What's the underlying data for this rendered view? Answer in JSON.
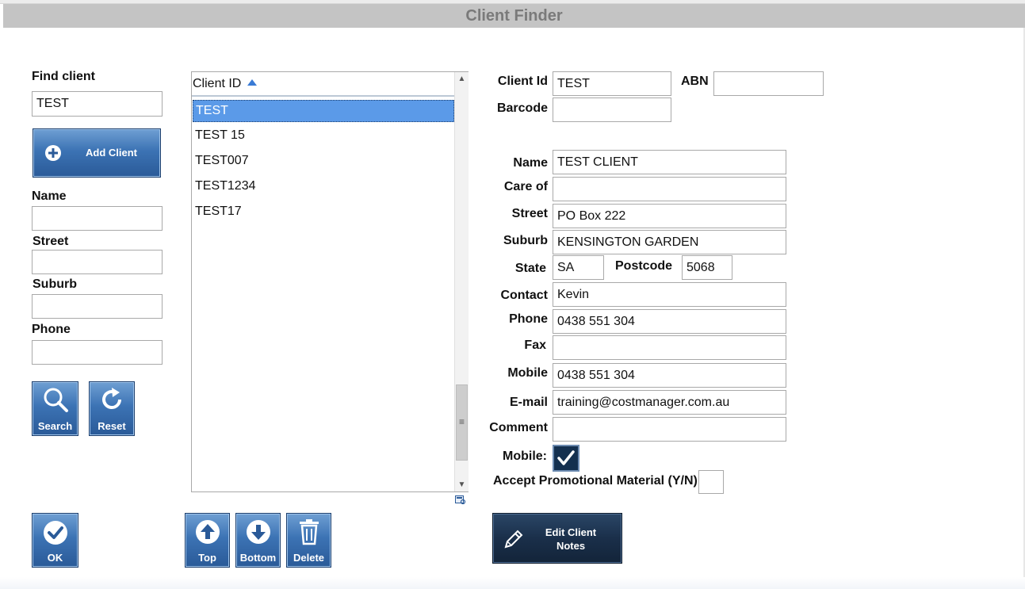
{
  "window": {
    "title": "Client Finder"
  },
  "search_panel": {
    "find_client_label": "Find client",
    "find_client_value": "TEST",
    "add_client_label": "Add Client",
    "name_label": "Name",
    "name_value": "",
    "street_label": "Street",
    "street_value": "",
    "suburb_label": "Suburb",
    "suburb_value": "",
    "phone_label": "Phone",
    "phone_value": "",
    "search_label": "Search",
    "reset_label": "Reset",
    "ok_label": "OK"
  },
  "client_list": {
    "column_header": "Client ID",
    "sort": "ascending",
    "rows": [
      "TEST",
      "TEST 15",
      "TEST007",
      "TEST1234",
      "TEST17"
    ],
    "selected_index": 0,
    "top_label": "Top",
    "bottom_label": "Bottom",
    "delete_label": "Delete"
  },
  "detail": {
    "client_id_label": "Client Id",
    "client_id_value": "TEST",
    "abn_label": "ABN",
    "abn_value": "",
    "barcode_label": "Barcode",
    "barcode_value": "",
    "name_label": "Name",
    "name_value": "TEST CLIENT",
    "care_of_label": "Care of",
    "care_of_value": "",
    "street_label": "Street",
    "street_value": "PO Box 222",
    "suburb_label": "Suburb",
    "suburb_value": "KENSINGTON GARDEN",
    "state_label": "State",
    "state_value": "SA",
    "postcode_label": "Postcode",
    "postcode_value": "5068",
    "contact_label": "Contact",
    "contact_value": "Kevin",
    "phone_label": "Phone",
    "phone_value": "0438 551 304",
    "fax_label": "Fax",
    "fax_value": "",
    "mobile_label": "Mobile",
    "mobile_value": "0438 551 304",
    "email_label": "E-mail",
    "email_value": "training@costmanager.com.au",
    "comment_label": "Comment",
    "comment_value": "",
    "mobile_check_label": "Mobile:",
    "mobile_checked": true,
    "promo_label": "Accept Promotional Material (Y/N)",
    "promo_checked": false,
    "edit_notes_line1": "Edit Client",
    "edit_notes_line2": "Notes"
  },
  "colors": {
    "title_bar": "#c4c4c4",
    "title_text": "#7a7a7a",
    "button_blue": "#3c73b4",
    "button_dark": "#1a2f4a",
    "selection": "#5b9ae8"
  }
}
